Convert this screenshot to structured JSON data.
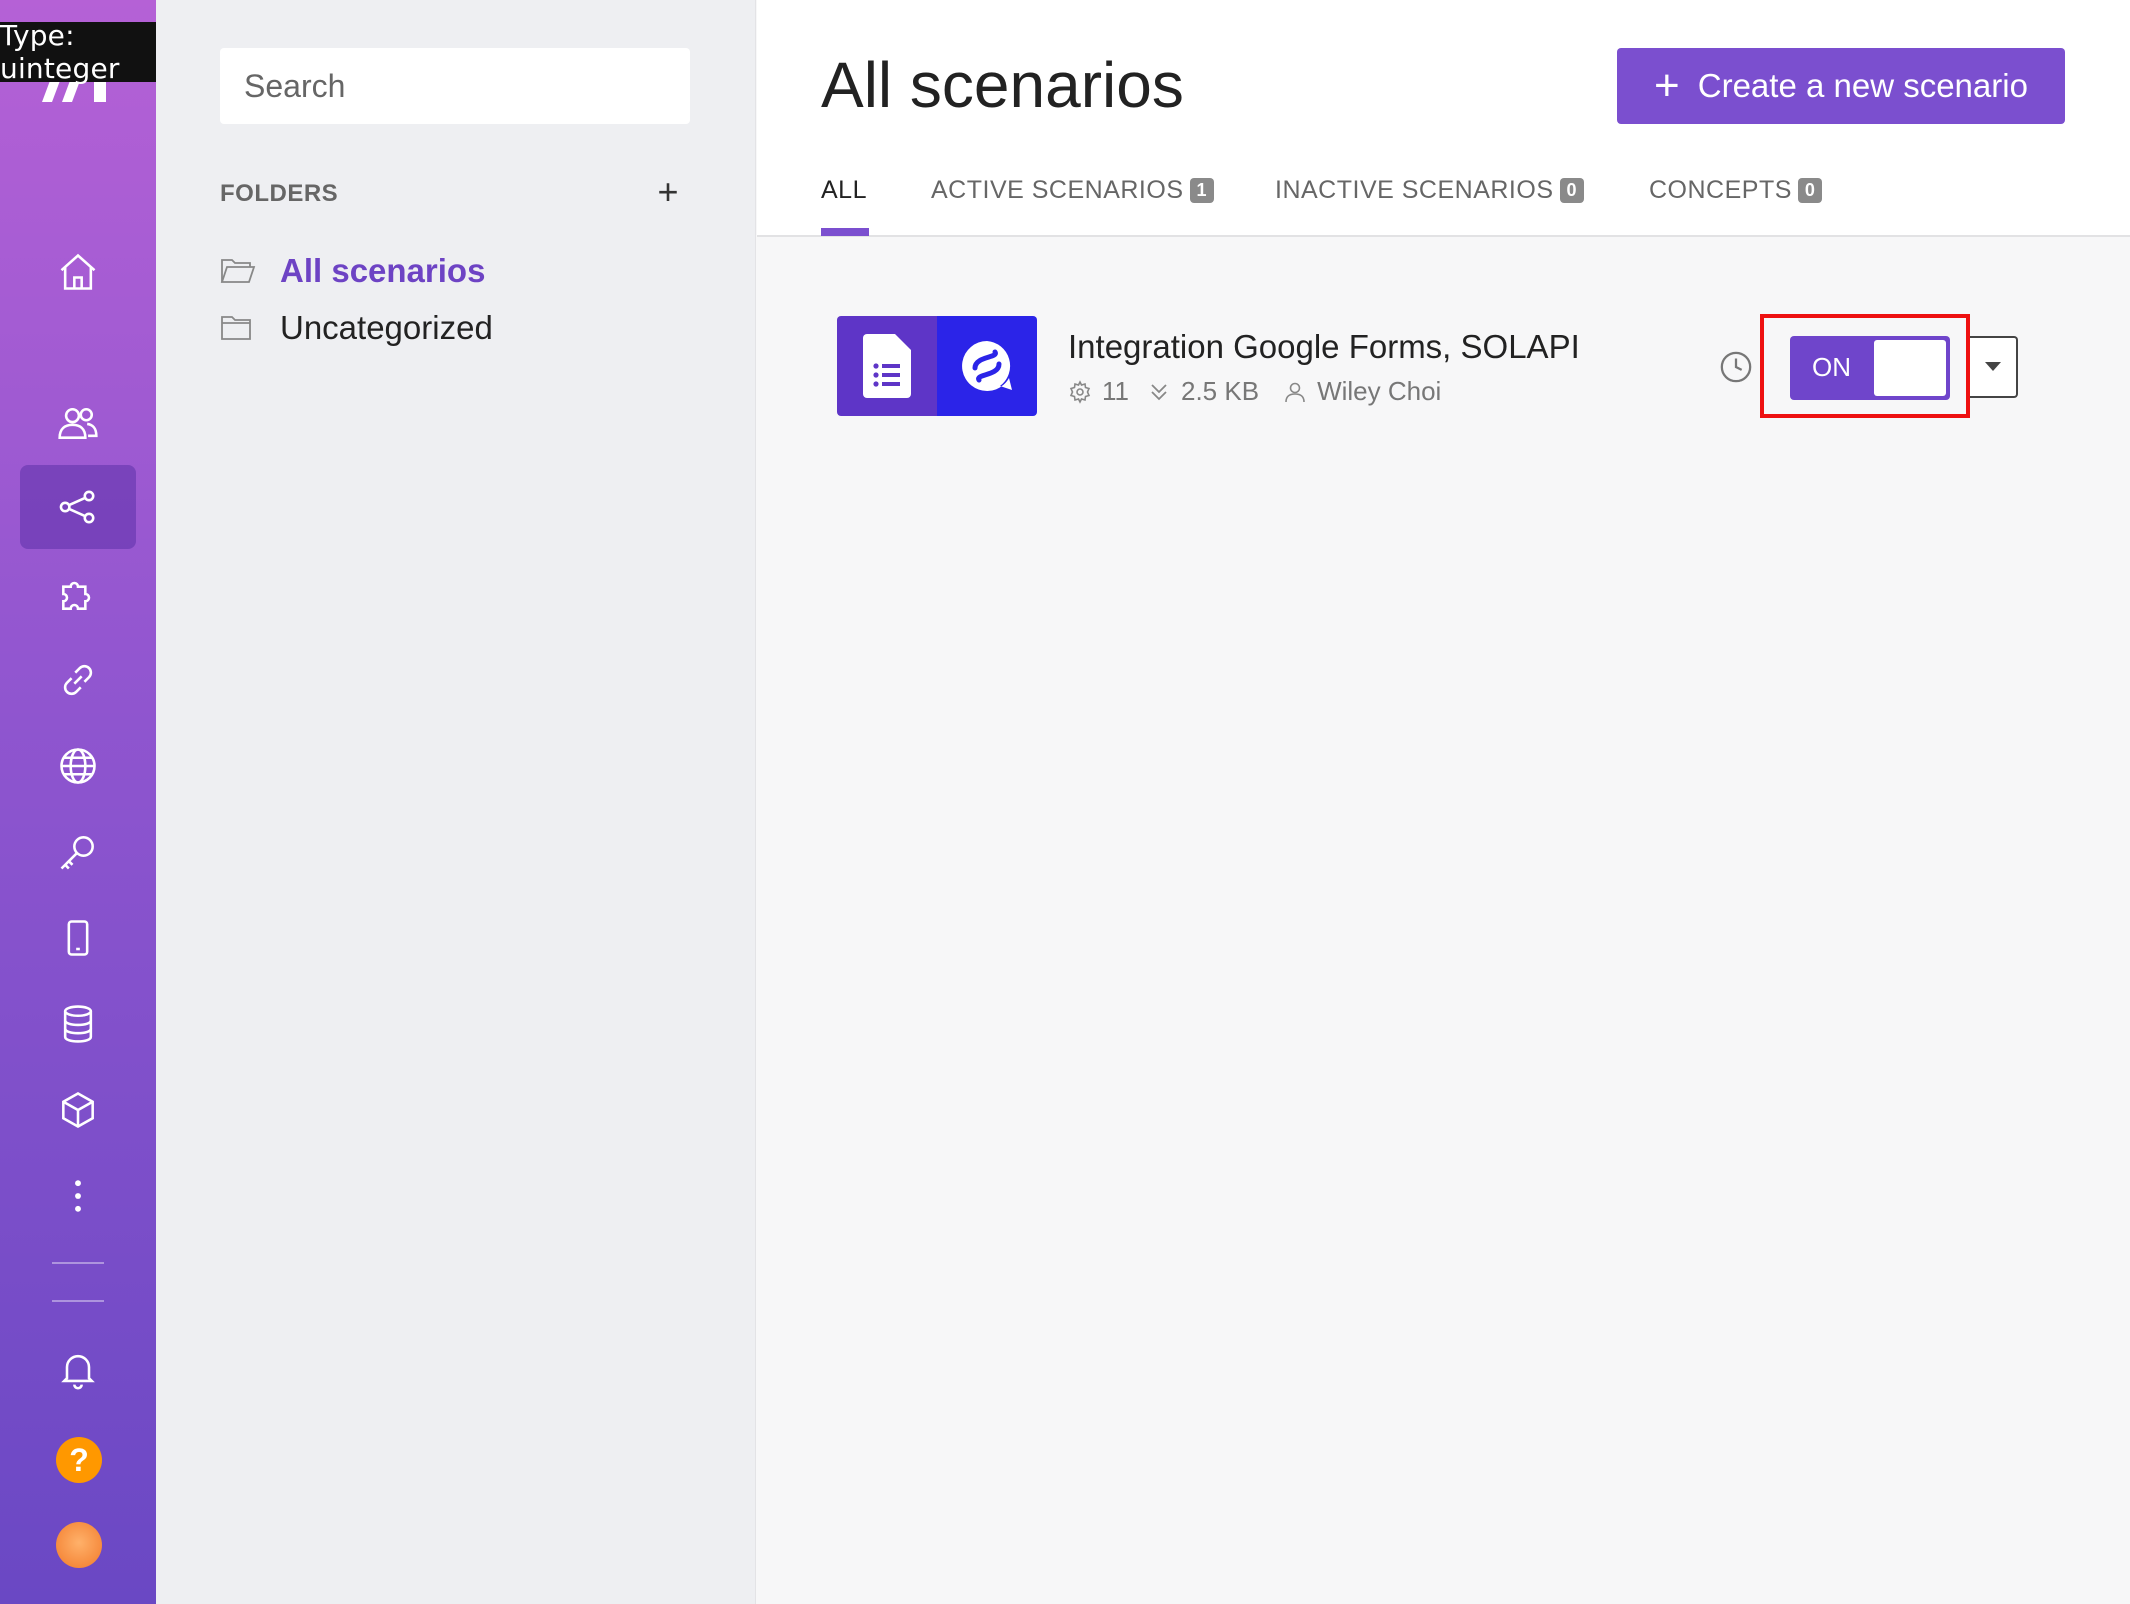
{
  "tooltip": {
    "text": "Type: uinteger"
  },
  "rail": {
    "items": [
      {
        "icon": "home-icon"
      },
      {
        "icon": "users-icon"
      },
      {
        "icon": "share-nodes-icon",
        "active": true
      },
      {
        "icon": "puzzle-icon"
      },
      {
        "icon": "link-icon"
      },
      {
        "icon": "globe-icon"
      },
      {
        "icon": "key-icon"
      },
      {
        "icon": "mobile-icon"
      },
      {
        "icon": "database-icon"
      },
      {
        "icon": "cube-icon"
      },
      {
        "icon": "more-vertical-icon"
      },
      {
        "icon": "bell-icon"
      }
    ],
    "help_label": "?"
  },
  "folders": {
    "search_placeholder": "Search",
    "heading": "FOLDERS",
    "add_label": "+",
    "items": [
      {
        "label": "All scenarios",
        "active": true
      },
      {
        "label": "Uncategorized",
        "active": false
      }
    ]
  },
  "main": {
    "title": "All scenarios",
    "create_button": "Create a new scenario",
    "tabs": [
      {
        "label": "ALL",
        "badge": ""
      },
      {
        "label": "ACTIVE SCENARIOS",
        "badge": "1"
      },
      {
        "label": "INACTIVE SCENARIOS",
        "badge": "0"
      },
      {
        "label": "CONCEPTS",
        "badge": "0"
      }
    ],
    "scenarios": [
      {
        "name": "Integration Google Forms, SOLAPI",
        "operations": "11",
        "data_size": "2.5 KB",
        "owner": "Wiley Choi",
        "toggle_label": "ON",
        "active": true
      }
    ]
  },
  "colors": {
    "accent": "#7b4fcf",
    "highlight": "#ee1111"
  }
}
